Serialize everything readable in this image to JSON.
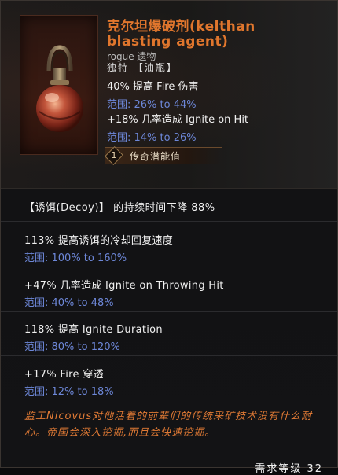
{
  "item": {
    "name": "克尔坦爆破剂(kelthan blasting agent)",
    "rarity": "rogue 遗物",
    "subtype": "独特 【油瓶】",
    "mods": [
      {
        "text": "40% 提高 Fire 伤害",
        "range": "范围: 26% to 44%"
      },
      {
        "text": "+18% 几率造成 Ignite on Hit",
        "range": "范围: 14% to 26%"
      }
    ],
    "legendary_potential": {
      "value": "1",
      "label": "传奇潜能值"
    }
  },
  "unique_mod": "【诱饵(Decoy)】 的持续时间下降 88%",
  "affixes": [
    {
      "text": "113% 提高诱饵的冷却回复速度",
      "range": "范围: 100% to 160%"
    },
    {
      "text": "+47% 几率造成 Ignite on Throwing Hit",
      "range": "范围: 40% to 48%"
    },
    {
      "text": "118% 提高 Ignite Duration",
      "range": "范围: 80% to 120%"
    },
    {
      "text": "+17% Fire 穿透",
      "range": "范围: 12% to 18%"
    }
  ],
  "lore": "监工Nicovus对他活着的前辈们的传统采矿技术没有什么耐心。帝国会深入挖掘,而且会快速挖掘。",
  "footer": "需求等级 32",
  "colors": {
    "title": "#e0762d",
    "range": "#6d87d8",
    "lore": "#e07a35",
    "text": "#f0f0f0"
  },
  "icons": {
    "item": "oil-flask-icon",
    "legendary": "diamond-badge-icon"
  }
}
